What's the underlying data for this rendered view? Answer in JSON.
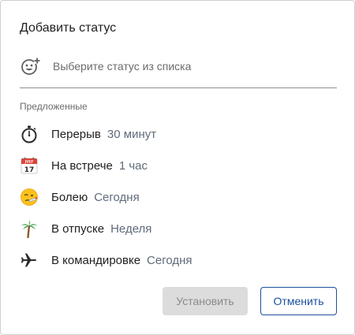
{
  "dialog": {
    "title": "Добавить статус"
  },
  "search": {
    "placeholder": "Выберите статус из списка",
    "value": "",
    "icon": "add-emoji-icon"
  },
  "suggested": {
    "label": "Предложенные",
    "items": [
      {
        "icon": "stopwatch-icon",
        "name": "Перерыв",
        "duration": "30 минут"
      },
      {
        "icon": "calendar-icon",
        "name": "На встрече",
        "duration": "1 час",
        "calendar_day": "17",
        "calendar_month": "JULY"
      },
      {
        "icon": "sick-face-icon",
        "name": "Болею",
        "duration": "Сегодня"
      },
      {
        "icon": "palm-tree-icon",
        "name": "В отпуске",
        "duration": "Неделя"
      },
      {
        "icon": "airplane-icon",
        "name": "В командировке",
        "duration": "Сегодня"
      }
    ]
  },
  "buttons": {
    "set_label": "Установить",
    "cancel_label": "Отменить"
  },
  "colors": {
    "accent": "#1a4f9c",
    "disabled_bg": "#dcdcdc",
    "disabled_text": "#8a8a8a",
    "secondary_text": "#5f6b7a"
  }
}
